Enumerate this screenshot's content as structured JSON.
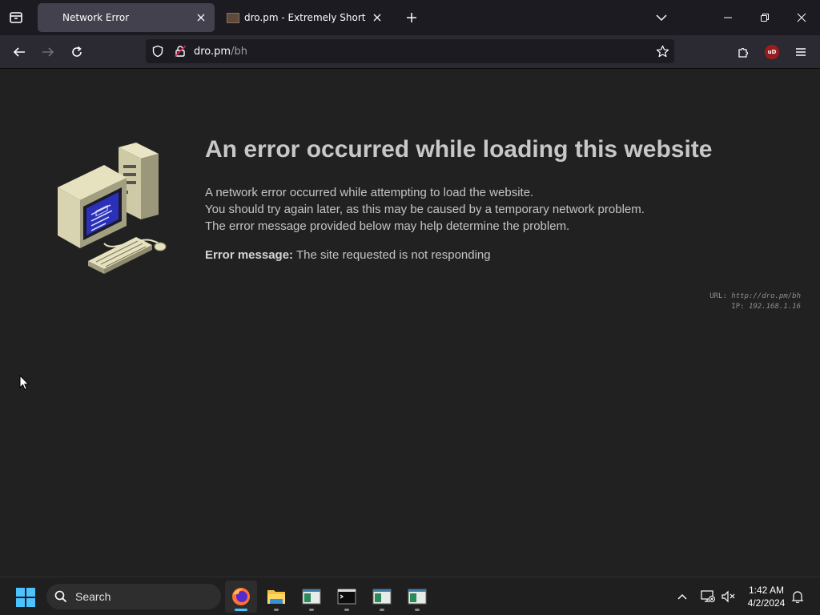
{
  "tabs": [
    {
      "title": "Network Error",
      "active": true
    },
    {
      "title": "dro.pm - Extremely Short Links",
      "active": false
    }
  ],
  "navbar": {
    "url_host": "dro.pm",
    "url_path": "/bh",
    "ublock_badge": "uD"
  },
  "page": {
    "title": "An error occurred while loading this website",
    "description_lines": [
      "A network error occurred while attempting to load the website.",
      "You should try again later, as this may be caused by a temporary network problem.",
      "The error message provided below may help determine the problem."
    ],
    "error_label": "Error message:",
    "error_text": " The site requested is not responding",
    "meta": {
      "url_label": "URL:",
      "url_value": "http://dro.pm/bh",
      "ip_label": "IP:",
      "ip_value": "192.168.1.16"
    }
  },
  "taskbar": {
    "search_label": "Search",
    "apps": [
      "firefox-icon",
      "file-explorer-icon",
      "window-app-icon",
      "terminal-icon",
      "window-app-icon",
      "window-app-icon"
    ],
    "time": "1:42 AM",
    "date": "4/2/2024"
  },
  "colors": {
    "accent": "#4cc2ff",
    "page_background": "#212121",
    "screen_blue": "#2b30b8"
  }
}
